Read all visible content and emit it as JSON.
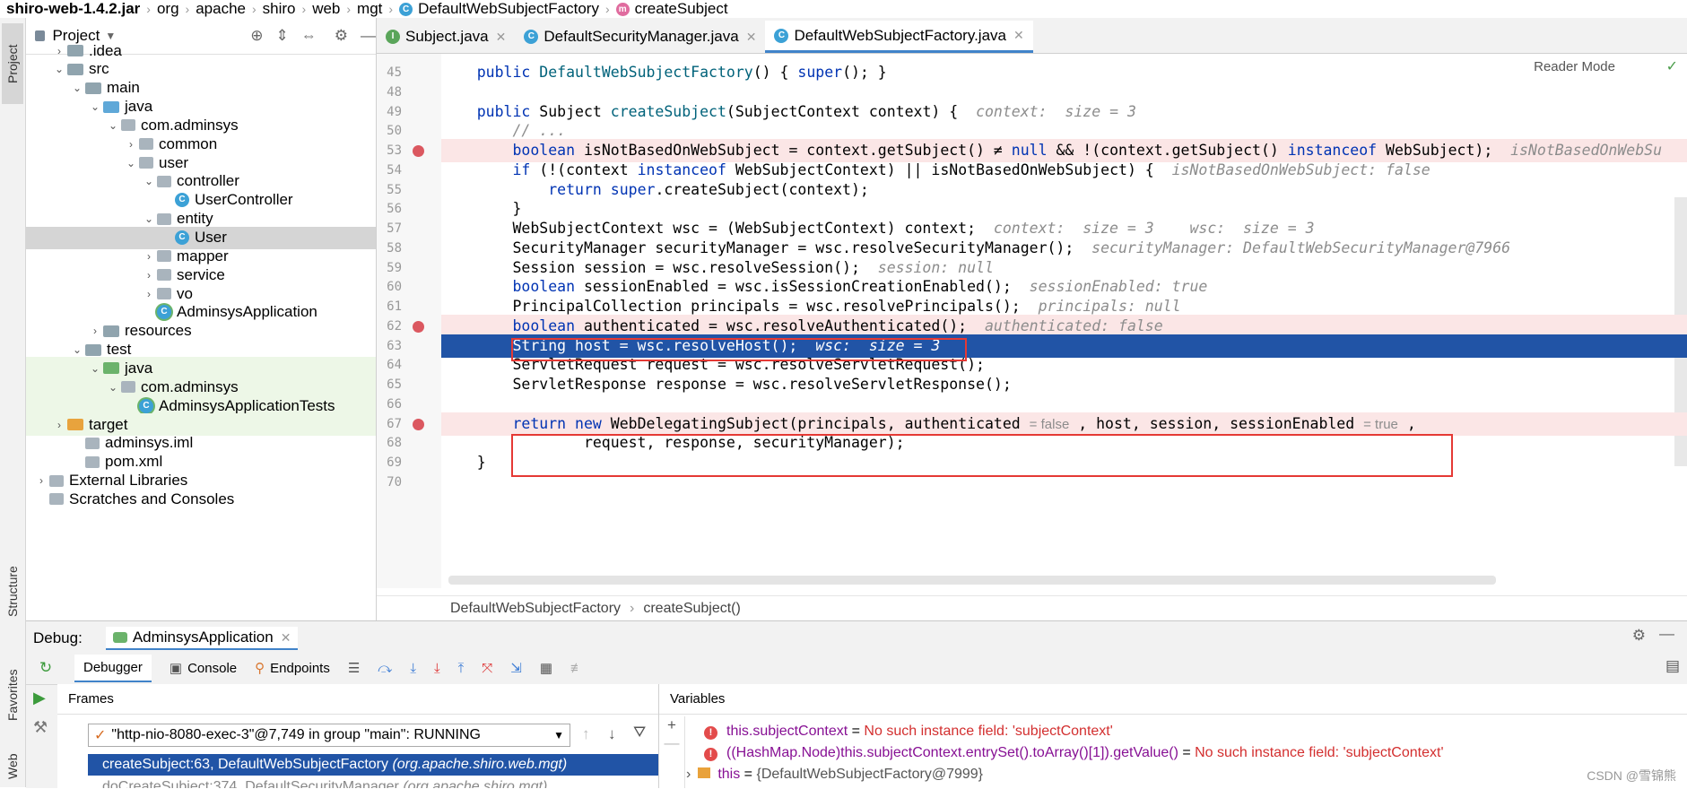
{
  "breadcrumb": [
    "shiro-web-1.4.2.jar",
    "org",
    "apache",
    "shiro",
    "web",
    "mgt",
    "DefaultWebSubjectFactory",
    "createSubject"
  ],
  "left_strip": {
    "project": "Project",
    "structure": "Structure",
    "favorites": "Favorites",
    "web": "Web"
  },
  "project_panel": {
    "title": "Project",
    "tree": [
      {
        "label": ".idea",
        "indent": 1,
        "arrow": "›",
        "icon": "folder"
      },
      {
        "label": "src",
        "indent": 1,
        "arrow": "⌄",
        "icon": "folder"
      },
      {
        "label": "main",
        "indent": 2,
        "arrow": "⌄",
        "icon": "folder"
      },
      {
        "label": "java",
        "indent": 3,
        "arrow": "⌄",
        "icon": "folder-blue"
      },
      {
        "label": "com.adminsys",
        "indent": 4,
        "arrow": "⌄",
        "icon": "package"
      },
      {
        "label": "common",
        "indent": 5,
        "arrow": "›",
        "icon": "package"
      },
      {
        "label": "user",
        "indent": 5,
        "arrow": "⌄",
        "icon": "package"
      },
      {
        "label": "controller",
        "indent": 6,
        "arrow": "⌄",
        "icon": "package"
      },
      {
        "label": "UserController",
        "indent": 7,
        "arrow": "",
        "icon": "class"
      },
      {
        "label": "entity",
        "indent": 6,
        "arrow": "⌄",
        "icon": "package"
      },
      {
        "label": "User",
        "indent": 7,
        "arrow": "",
        "icon": "class",
        "selected": true
      },
      {
        "label": "mapper",
        "indent": 6,
        "arrow": "›",
        "icon": "package"
      },
      {
        "label": "service",
        "indent": 6,
        "arrow": "›",
        "icon": "package"
      },
      {
        "label": "vo",
        "indent": 6,
        "arrow": "›",
        "icon": "package"
      },
      {
        "label": "AdminsysApplication",
        "indent": 6,
        "arrow": "",
        "icon": "class-spring"
      },
      {
        "label": "resources",
        "indent": 3,
        "arrow": "›",
        "icon": "folder"
      },
      {
        "label": "test",
        "indent": 2,
        "arrow": "⌄",
        "icon": "folder"
      },
      {
        "label": "java",
        "indent": 3,
        "arrow": "⌄",
        "icon": "folder-green",
        "test": true
      },
      {
        "label": "com.adminsys",
        "indent": 4,
        "arrow": "⌄",
        "icon": "package",
        "test": true
      },
      {
        "label": "AdminsysApplicationTests",
        "indent": 5,
        "arrow": "",
        "icon": "class-spring",
        "test": true
      },
      {
        "label": "target",
        "indent": 1,
        "arrow": "›",
        "icon": "folder-orange",
        "test": true
      },
      {
        "label": "adminsys.iml",
        "indent": 2,
        "arrow": "",
        "icon": "file"
      },
      {
        "label": "pom.xml",
        "indent": 2,
        "arrow": "",
        "icon": "maven"
      },
      {
        "label": "External Libraries",
        "indent": 0,
        "arrow": "›",
        "icon": "libs"
      },
      {
        "label": "Scratches and Consoles",
        "indent": 0,
        "arrow": "",
        "icon": "scratch"
      }
    ]
  },
  "tabs": [
    {
      "label": "Subject.java",
      "icon": "I",
      "active": false
    },
    {
      "label": "DefaultSecurityManager.java",
      "icon": "C",
      "active": false
    },
    {
      "label": "DefaultWebSubjectFactory.java",
      "icon": "C",
      "active": true
    }
  ],
  "editor": {
    "reader_mode": "Reader Mode",
    "lines": [
      {
        "n": "45",
        "html": "    <span class='kw'>public</span> <span class='fn'>DefaultWebSubjectFactory</span>() { <span class='kw'>super</span>(); }"
      },
      {
        "n": "48",
        "html": ""
      },
      {
        "n": "49",
        "html": "    <span class='kw'>public</span> Subject <span class='fn'>createSubject</span>(SubjectContext context) {  <span class='hint'>context:  size = 3</span>"
      },
      {
        "n": "50",
        "html": "        <span class='hint'>// ...</span>"
      },
      {
        "n": "53",
        "html": "        <span class='kw'>boolean</span> isNotBasedOnWebSubject = context.getSubject() ≠ <span class='kw'>null</span> &amp;&amp; !(context.getSubject() <span class='kw'>instanceof</span> WebSubject);  <span class='hint'>isNotBasedOnWebSu</span>",
        "bp": true
      },
      {
        "n": "54",
        "html": "        <span class='kw'>if</span> (!(context <span class='kw'>instanceof</span> WebSubjectContext) || isNotBasedOnWebSubject) {  <span class='hint'>isNotBasedOnWebSubject: false</span>"
      },
      {
        "n": "55",
        "html": "            <span class='kw'>return</span> <span class='kw'>super</span>.createSubject(context);"
      },
      {
        "n": "56",
        "html": "        }"
      },
      {
        "n": "57",
        "html": "        WebSubjectContext wsc = (WebSubjectContext) context;  <span class='hint'>context:  size = 3    wsc:  size = 3</span>"
      },
      {
        "n": "58",
        "html": "        SecurityManager securityManager = wsc.resolveSecurityManager();  <span class='hint'>securityManager: DefaultWebSecurityManager@7966</span>"
      },
      {
        "n": "59",
        "html": "        Session session = wsc.resolveSession();  <span class='hint'>session: null</span>"
      },
      {
        "n": "60",
        "html": "        <span class='kw'>boolean</span> sessionEnabled = wsc.isSessionCreationEnabled();  <span class='hint'>sessionEnabled: true</span>"
      },
      {
        "n": "61",
        "html": "        PrincipalCollection principals = wsc.resolvePrincipals();  <span class='hint'>principals: null</span>"
      },
      {
        "n": "62",
        "html": "        <span class='kw'>boolean</span> authenticated = wsc.resolveAuthenticated();  <span class='hint'>authenticated: false</span>",
        "bp": true
      },
      {
        "n": "63",
        "html": "        String host = wsc.resolveHost();  <span class='hint'>wsc:  size = 3</span>",
        "current": true
      },
      {
        "n": "64",
        "html": "        ServletRequest request = wsc.resolveServletRequest();"
      },
      {
        "n": "65",
        "html": "        ServletResponse response = wsc.resolveServletResponse();"
      },
      {
        "n": "66",
        "html": ""
      },
      {
        "n": "67",
        "html": "        <span class='kw'>return</span> <span class='kw'>new</span> WebDelegatingSubject(principals, authenticated <span class='inl'>= false</span> , host, session, sessionEnabled <span class='inl'>= true</span> ,",
        "bp": true
      },
      {
        "n": "68",
        "html": "                request, response, securityManager);"
      },
      {
        "n": "69",
        "html": "    }"
      },
      {
        "n": "70",
        "html": ""
      }
    ],
    "crumb": [
      "DefaultWebSubjectFactory",
      "createSubject()"
    ]
  },
  "debug": {
    "label": "Debug:",
    "config": "AdminsysApplication",
    "tabs": [
      "Debugger",
      "Console",
      "Endpoints"
    ],
    "frames_title": "Frames",
    "thread": "\"http-nio-8080-exec-3\"@7,749 in group \"main\": RUNNING",
    "frames": [
      {
        "text": "createSubject:63, DefaultWebSubjectFactory",
        "pkg": "(org.apache.shiro.web.mgt)",
        "selected": true
      },
      {
        "text": "doCreateSubject:374, DefaultSecurityManager",
        "pkg": "(org.apache.shiro.mgt)",
        "selected": false
      }
    ],
    "variables_title": "Variables",
    "variables": [
      {
        "name": "this.subjectContext",
        "value": "No such instance field: 'subjectContext'",
        "type": "error"
      },
      {
        "name": "((HashMap.Node)this.subjectContext.entrySet().toArray()[1]).getValue()",
        "value": "No such instance field: 'subjectContext'",
        "type": "error"
      },
      {
        "name": "this",
        "value": "{DefaultWebSubjectFactory@7999}",
        "type": "object"
      }
    ]
  },
  "watermark": "CSDN @雪锦熊",
  "colors": {
    "accent": "#4083c9",
    "current_line": "#2154a6",
    "breakpoint": "#db5860",
    "error": "#e53935"
  }
}
